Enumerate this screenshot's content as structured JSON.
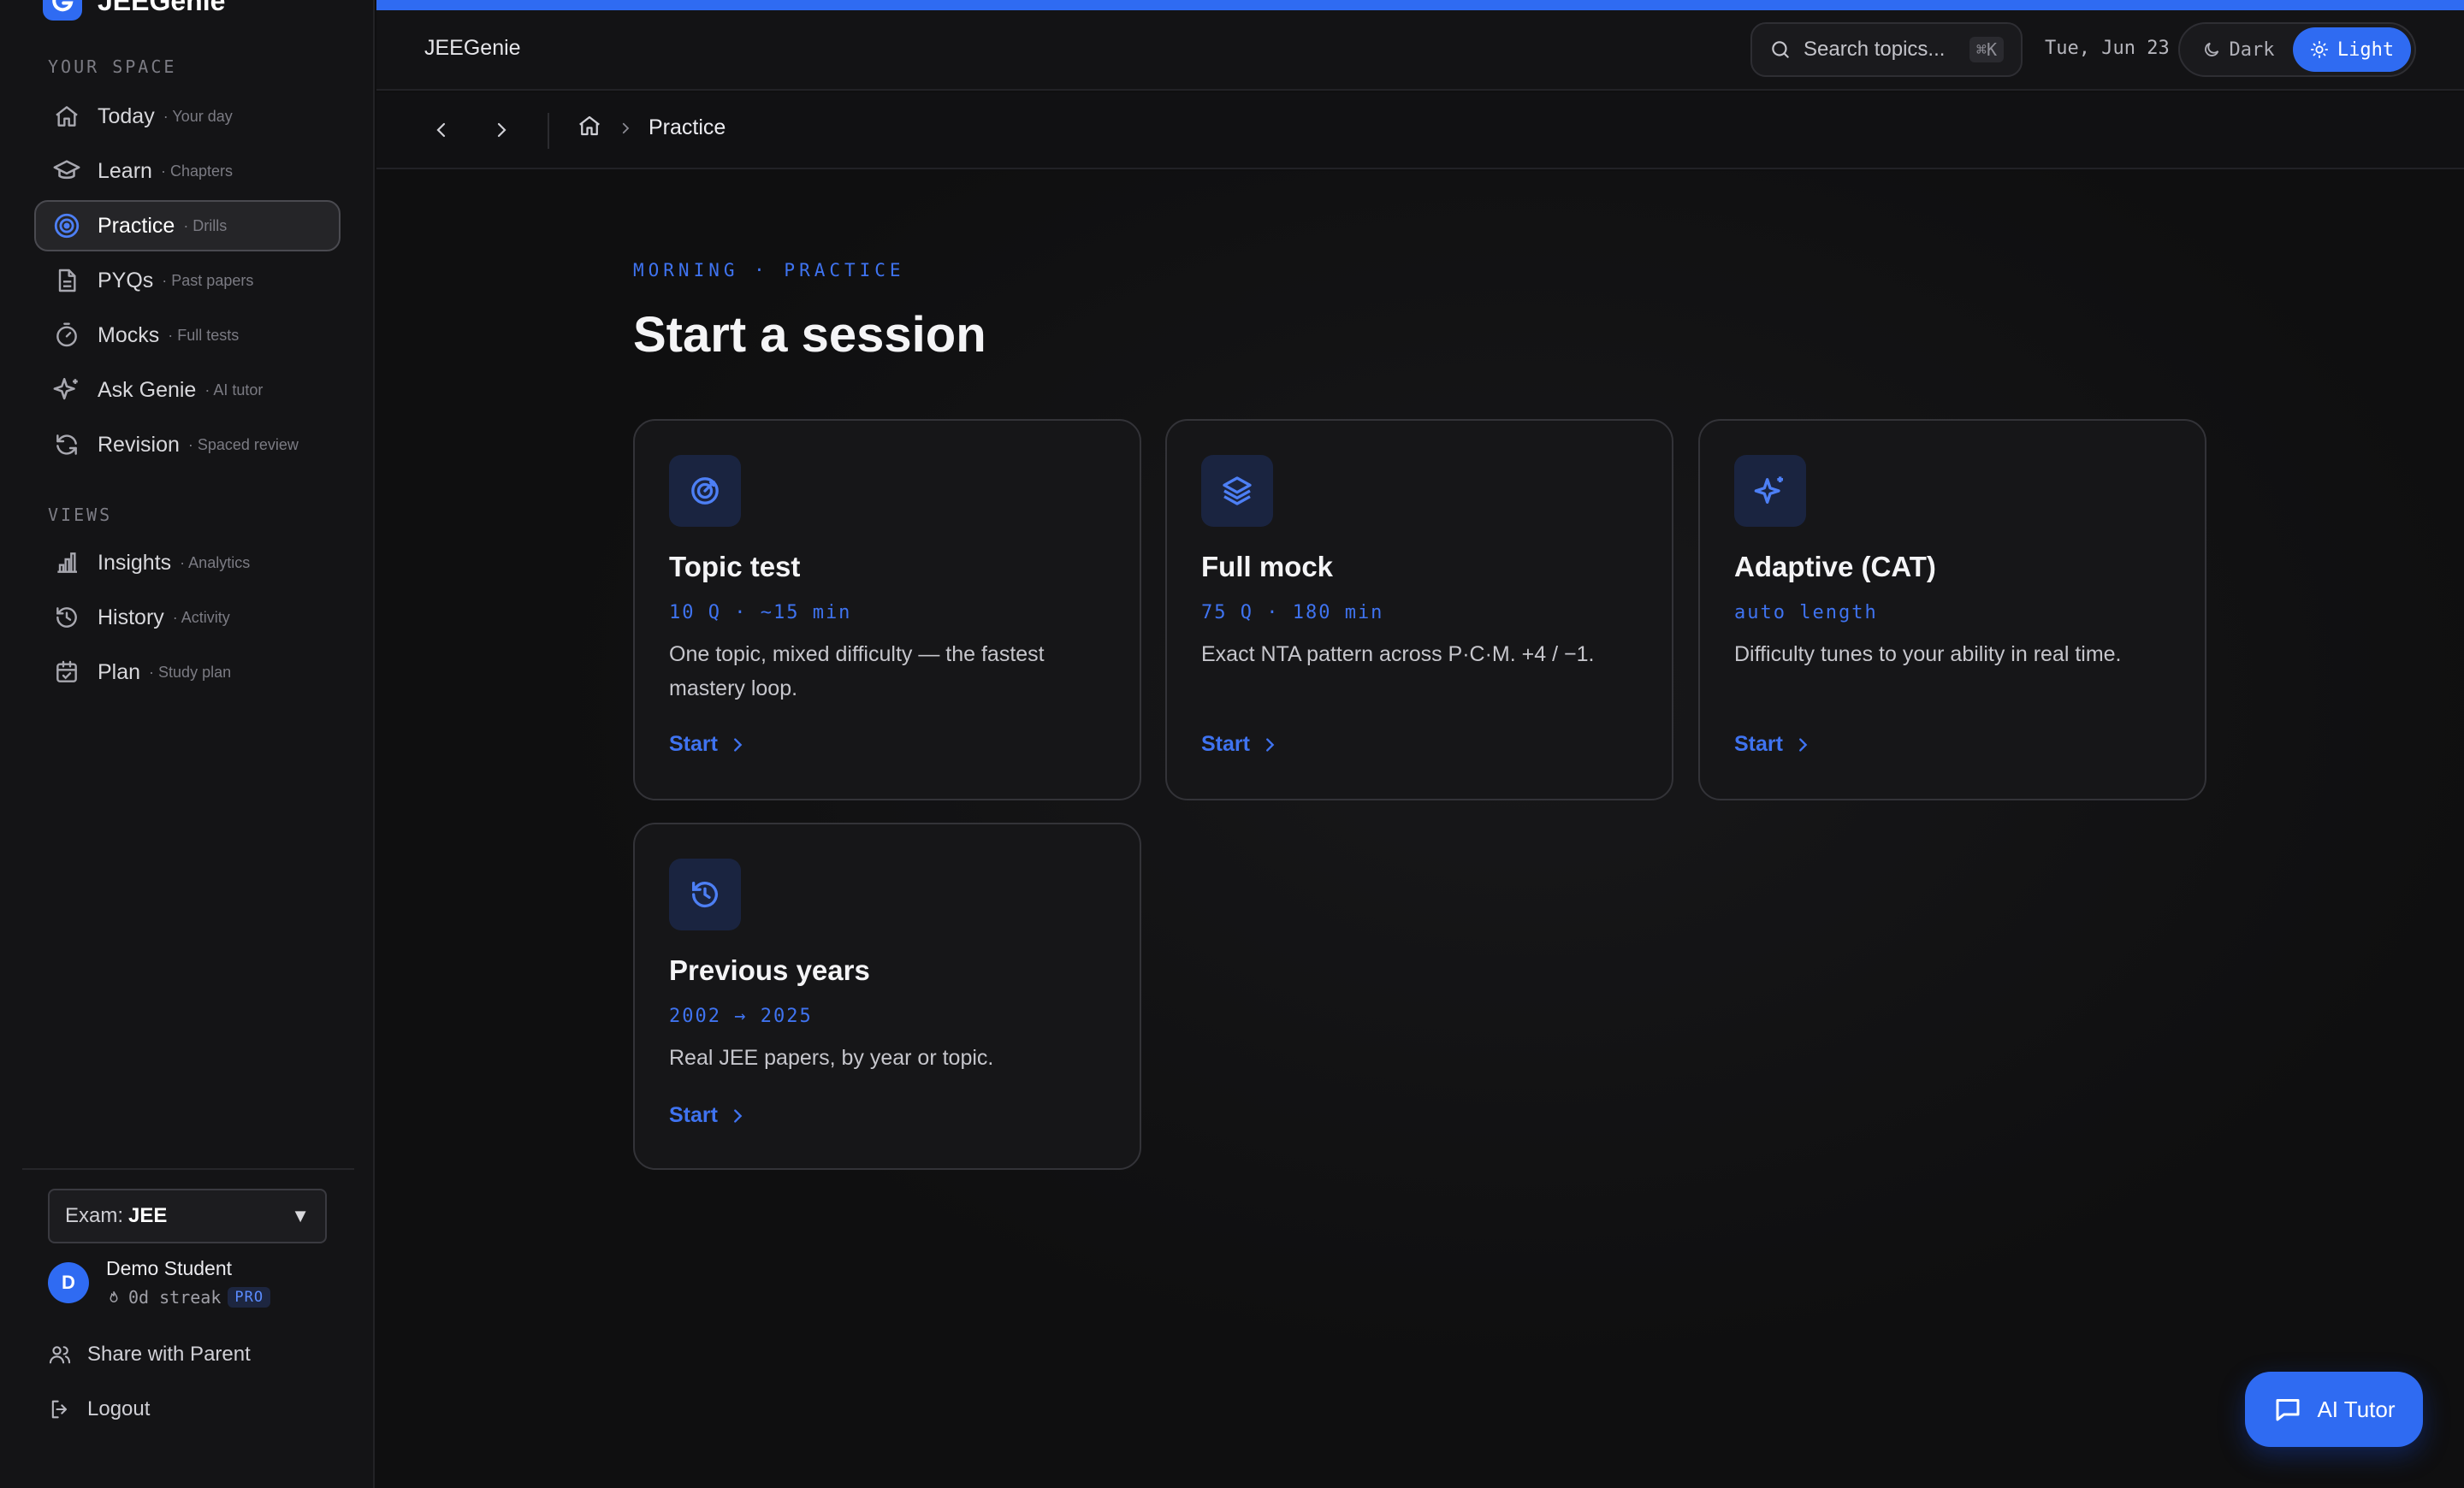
{
  "brand": {
    "name": "JEEGenie"
  },
  "sidebar": {
    "section_space": "YOUR SPACE",
    "section_views": "VIEWS",
    "items": [
      {
        "label": "Today",
        "sub": "· Your day",
        "icon": "home-icon"
      },
      {
        "label": "Learn",
        "sub": "· Chapters",
        "icon": "graduation-cap-icon"
      },
      {
        "label": "Practice",
        "sub": "· Drills",
        "icon": "target-icon",
        "active": true
      },
      {
        "label": "PYQs",
        "sub": "· Past papers",
        "icon": "document-icon"
      },
      {
        "label": "Mocks",
        "sub": "· Full tests",
        "icon": "stopwatch-icon"
      },
      {
        "label": "Ask Genie",
        "sub": "· AI tutor",
        "icon": "sparkle-icon"
      },
      {
        "label": "Revision",
        "sub": "· Spaced review",
        "icon": "refresh-icon"
      }
    ],
    "views": [
      {
        "label": "Insights",
        "sub": "· Analytics",
        "icon": "bar-chart-icon"
      },
      {
        "label": "History",
        "sub": "· Activity",
        "icon": "history-icon"
      },
      {
        "label": "Plan",
        "sub": "· Study plan",
        "icon": "calendar-icon"
      }
    ],
    "exam_prefix": "Exam:",
    "exam_value": "JEE",
    "user": {
      "initial": "D",
      "name": "Demo Student",
      "streak": "0d streak",
      "badge": "PRO"
    },
    "share_label": "Share with Parent",
    "logout_label": "Logout"
  },
  "topbar": {
    "title": "JEEGenie",
    "search_placeholder": "Search topics...",
    "search_shortcut": "⌘K",
    "date": "Tue, Jun 23",
    "theme_dark": "Dark",
    "theme_light": "Light",
    "theme_selected": "Light"
  },
  "breadcrumb": {
    "current": "Practice"
  },
  "main": {
    "eyebrow": "MORNING · PRACTICE",
    "heading": "Start a session",
    "cards": [
      {
        "title": "Topic test",
        "meta": "10 Q · ~15 min",
        "desc": "One topic, mixed difficulty — the fastest mastery loop.",
        "start": "Start",
        "icon": "target-icon"
      },
      {
        "title": "Full mock",
        "meta": "75 Q · 180 min",
        "desc": "Exact NTA pattern across P·C·M. +4 / −1.",
        "start": "Start",
        "icon": "layers-icon"
      },
      {
        "title": "Adaptive (CAT)",
        "meta": "auto length",
        "desc": "Difficulty tunes to your ability in real time.",
        "start": "Start",
        "icon": "sparkle-icon"
      },
      {
        "title": "Previous years",
        "meta": "2002 → 2025",
        "desc": "Real JEE papers, by year or topic.",
        "start": "Start",
        "icon": "history-icon"
      }
    ]
  },
  "ai_tutor": {
    "label": "AI Tutor"
  },
  "colors": {
    "accent": "#2f6bf2",
    "accent_text": "#3f73f0",
    "background": "#0f0f10",
    "sidebar": "#141416"
  }
}
